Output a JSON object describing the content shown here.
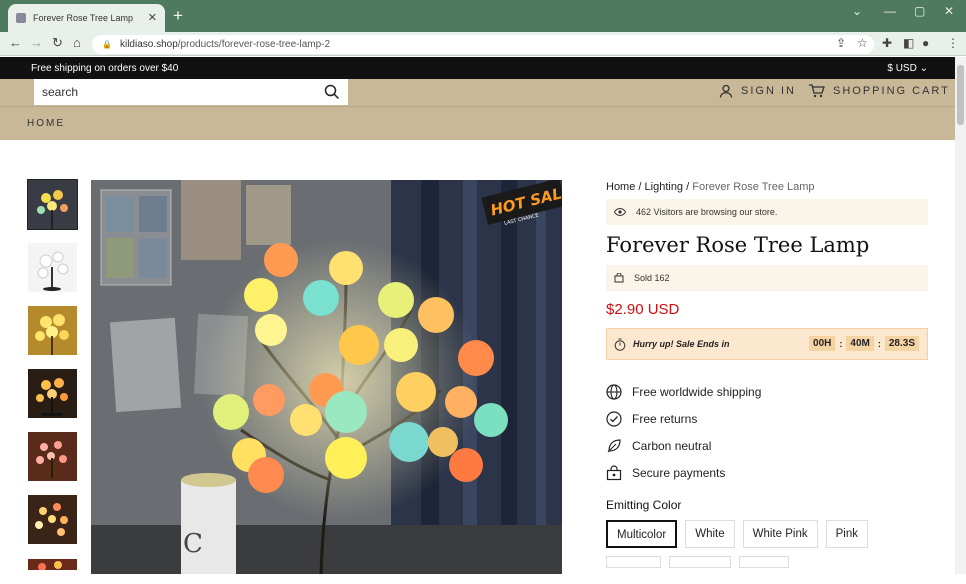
{
  "browser": {
    "tab_title": "Forever Rose Tree Lamp",
    "url_domain": "kildiaso.shop",
    "url_path": "/products/forever-rose-tree-lamp-2"
  },
  "promo": {
    "text": "Free shipping on orders over $40",
    "currency": "$ USD"
  },
  "header": {
    "search_placeholder": "search",
    "sign_in": "SIGN IN",
    "cart": "SHOPPING CART",
    "nav_home": "HOME"
  },
  "product": {
    "breadcrumb_home": "Home",
    "breadcrumb_cat": "Lighting",
    "breadcrumb_current": "Forever Rose Tree Lamp",
    "visitors": "462 Visitors are browsing our store.",
    "title": "Forever Rose Tree Lamp",
    "sold": "Sold 162",
    "price": "$2.90 USD",
    "sale_text": "Hurry up! Sale Ends in",
    "timer_h": "00H",
    "timer_m": "40M",
    "timer_s": "28.3S",
    "features": [
      "Free worldwide shipping",
      "Free returns",
      "Carbon neutral",
      "Secure payments"
    ],
    "color_label": "Emitting Color",
    "colors": [
      "Multicolor",
      "White",
      "White Pink",
      "Pink"
    ],
    "hot_sale_badge": "HOT SALE",
    "hot_sale_sub": "LAST CHANCE",
    "mug_letter": "C"
  },
  "colors": {
    "browser_chrome": "#4f7a60",
    "header_bg": "#c9b898",
    "price": "#d10f0f",
    "sale_bg": "#fce7cf"
  },
  "icons": [
    "favicon",
    "close-icon",
    "plus-icon",
    "back-icon",
    "forward-icon",
    "reload-icon",
    "home-icon",
    "lock-icon",
    "share-icon",
    "star-icon",
    "puzzle-icon",
    "sidebar-icon",
    "profile-icon",
    "menu-icon",
    "search-icon",
    "user-icon",
    "cart-icon",
    "eye-icon",
    "bag-icon",
    "stopwatch-icon",
    "globe-icon",
    "check-circle-icon",
    "leaf-icon",
    "secure-icon"
  ]
}
